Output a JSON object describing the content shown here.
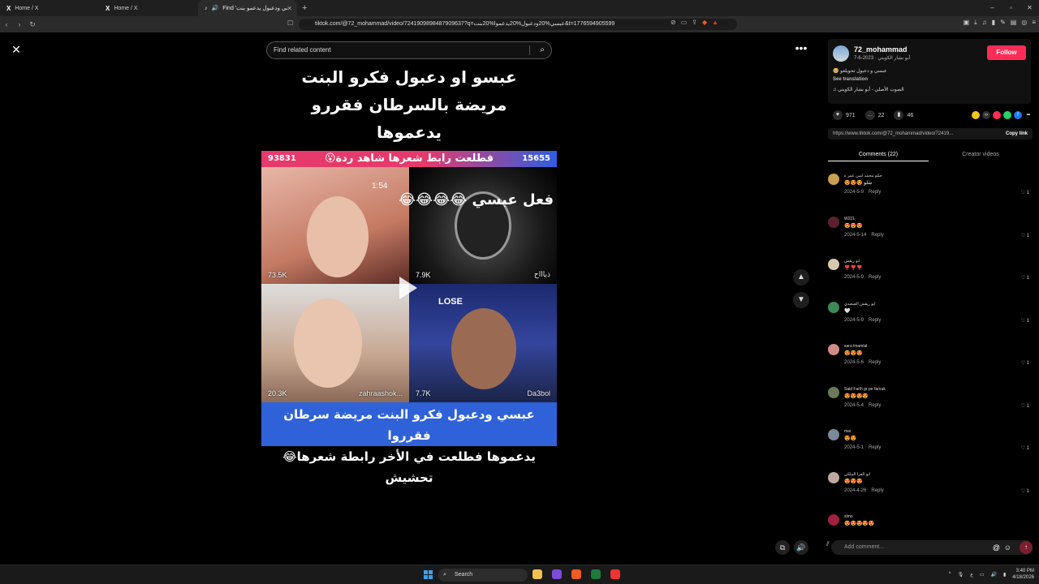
{
  "browser": {
    "tabs": [
      {
        "icon": "X",
        "title": "Home / X"
      },
      {
        "icon": "X",
        "title": "Home / X"
      },
      {
        "icon": "tiktok",
        "title": "Find 'عبسي ودعبول يدعمو بنت"
      }
    ],
    "new_tab": "+",
    "url": "tiktok.com/@72_mohammad/video/7241909898487909637?q=عبسي%20ودعبول%20يدعموا%20بنت&t=1776594905599",
    "window_controls": [
      "–",
      "▫",
      "✕"
    ]
  },
  "search": {
    "placeholder": "Find related content"
  },
  "video": {
    "title_lines": [
      "عبسو او دعبول فكرو البنت",
      "مريضة بالسرطان فقررو",
      "يدعموها"
    ],
    "banner": "فطلعت رابط شعرها شاهد ردة😮",
    "score_left": "93831",
    "score_right": "15655",
    "timer": "1:54",
    "round_label": "جولة النصر",
    "overlay": "فعل عبسي 😂😂😂😂",
    "tiles": [
      {
        "count": "73.5K",
        "name": ""
      },
      {
        "count": "7.9K",
        "name": "ذباااح"
      },
      {
        "count": "20.3K",
        "name": "zahraashok..."
      },
      {
        "count": "7.7K",
        "name": "Da3bol"
      }
    ],
    "lose": "LOSE",
    "caption_lines": [
      "عبسي ودعبول فكرو البنت مريضة سرطان فقرروا",
      "يدعموها  فطلعت في الأخر رابطة شعرها😂تحشيش"
    ]
  },
  "controls": {
    "more": "•••",
    "up": "▲",
    "down": "▼"
  },
  "profile": {
    "username": "72_mohammad",
    "subline": "أبو بشار الكويتي · 2023-6-7",
    "follow": "Follow",
    "description": "عبسي و دعبول تحويلغو 🥺",
    "see_translation": "See translation",
    "sound": "♫ الصوت الأصلي - أبو بشار الكويتي"
  },
  "stats": {
    "likes": "971",
    "comments": "22",
    "saves": "46"
  },
  "link": {
    "url": "https://www.tiktok.com/@72_mohammad/video/72419...",
    "copy": "Copy link"
  },
  "comment_tabs": [
    "Comments (22)",
    "Creator videos"
  ],
  "comments": [
    {
      "name": "حكم محمد امين عمر ه",
      "text": "😍😍😍 شلو",
      "date": "2024-5-9",
      "reply": "Reply",
      "likes": "1",
      "avatar_color": "#c7a050"
    },
    {
      "name": "W221",
      "text": "😍😍😍",
      "date": "2024-5-14",
      "reply": "Reply",
      "likes": "1",
      "avatar_color": "#5a2030"
    },
    {
      "name": "ابو ريقش",
      "text": "❣️❣️❣️",
      "date": "2024-5-9",
      "reply": "Reply",
      "likes": "1",
      "avatar_color": "#d8c8b0"
    },
    {
      "name": "ابو ريقش الصعيدي",
      "text": "🤍",
      "date": "2024-5-9",
      "reply": "Reply",
      "likes": "1",
      "avatar_color": "#3a8a5a"
    },
    {
      "name": "sara lmamlal",
      "text": "😍😍😍",
      "date": "2024-5-6",
      "reply": "Reply",
      "likes": "1",
      "avatar_color": "#d08a8a"
    },
    {
      "name": "Said Farih gr pe farouk",
      "text": "😍😍😍😍",
      "date": "2024-5-4",
      "reply": "Reply",
      "likes": "1",
      "avatar_color": "#6a7a5a"
    },
    {
      "name": "mai",
      "text": "😍😍",
      "date": "2024-5-1",
      "reply": "Reply",
      "likes": "1",
      "avatar_color": "#7a8a9a"
    },
    {
      "name": "ابو الفرا الملكي",
      "text": "😍😍😍",
      "date": "2024-4-26",
      "reply": "Reply",
      "likes": "1",
      "avatar_color": "#c0a8a0"
    },
    {
      "name": "slmo",
      "text": "😍😍😍😍😍",
      "date": "",
      "reply": "",
      "likes": "",
      "avatar_color": "#a02040"
    }
  ],
  "comment_input": {
    "placeholder": "Add comment..."
  },
  "taskbar": {
    "search": "Search",
    "time": "3:40 PM",
    "date": "4/18/2026"
  }
}
